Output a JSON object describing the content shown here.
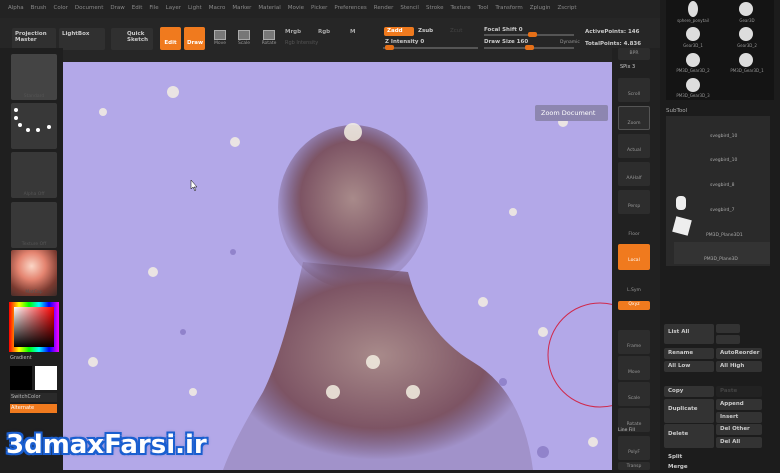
{
  "menu": [
    "Alpha",
    "Brush",
    "Color",
    "Document",
    "Draw",
    "Edit",
    "File",
    "Layer",
    "Light",
    "Macro",
    "Marker",
    "Material",
    "Movie",
    "Picker",
    "Preferences",
    "Render",
    "Stencil",
    "Stroke",
    "Texture",
    "Tool",
    "Transform",
    "Zplugin",
    "Zscript"
  ],
  "toolbar": {
    "projection_master": "Projection Master",
    "lightbox": "LightBox",
    "quick_sketch": "Quick Sketch",
    "edit": "Edit",
    "draw": "Draw",
    "move": "Move",
    "scale": "Scale",
    "rotate": "Rotate",
    "mrgb": "Mrgb",
    "rgb": "Rgb",
    "m": "M",
    "rgb_intensity": "Rgb Intensity",
    "zadd": "Zadd",
    "zsub": "Zsub",
    "zcut": "Zcut",
    "z_intensity": "Z Intensity 0",
    "focal_shift": "Focal Shift 0",
    "draw_size": "Draw Size 160",
    "dynamic": "Dynamic",
    "active_points": "ActivePoints: 146",
    "total_points": "TotalPoints: 4.836"
  },
  "left": {
    "thumbs": [
      "Standard",
      "Dots",
      "Alpha Off",
      "Texture Off",
      "MatCap"
    ],
    "gradient": "Gradient",
    "switch_color": "SwitchColor",
    "alternate": "Alternate",
    "primary_color": "#000000",
    "secondary_color": "#ffffff"
  },
  "tooltip": "Zoom Document",
  "shelf": [
    "BPR",
    "SPix 3",
    "Scroll",
    "Zoom",
    "Actual",
    "AAHalf",
    "Persp",
    "Floor",
    "Local",
    "L.Sym",
    "Qxyz",
    "Frame",
    "Move",
    "Scale",
    "Rotate",
    "Line Fill",
    "PolyF",
    "Transp"
  ],
  "tool_thumbs": [
    "sphere_ponytail",
    "Gear3D",
    "Gear3D_1",
    "Gear3D_2",
    "PM3D_Gear3D_2",
    "PM3D_Gear3D_1",
    "PM3D_Gear3D_3"
  ],
  "subtool": {
    "title": "SubTool",
    "items": [
      "",
      "svegbird_10",
      "svegbird_10",
      "svegbird_8",
      "svegbird_7",
      "PM3D_Plane3D1",
      "PM3D_Plane3D"
    ]
  },
  "subtool_buttons": {
    "list_all": "List All",
    "rename": "Rename",
    "auto_reorder": "AutoReorder",
    "all_low": "All Low",
    "all_high": "All High",
    "copy": "Copy",
    "paste": "Paste",
    "duplicate": "Duplicate",
    "append": "Append",
    "insert": "Insert",
    "delete": "Delete",
    "del_other": "Del Other",
    "del_all": "Del All",
    "split": "Split",
    "merge": "Merge"
  },
  "watermark": "3dmaxFarsi.ir",
  "colors": {
    "accent": "#f07a1e",
    "canvas": "#b3a8e8"
  }
}
